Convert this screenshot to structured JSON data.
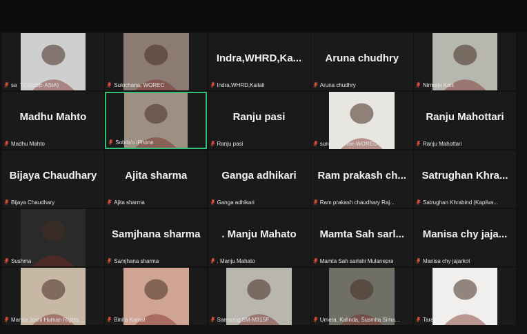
{
  "tiles": [
    {
      "name": "",
      "label": "sa  TOSUSE-ASIA)",
      "video": true,
      "bg": "#cfcfcf"
    },
    {
      "name": "",
      "label": "Sulochana, WOREC",
      "video": true,
      "bg": "#8c7b73"
    },
    {
      "name": "Indra,WHRD,Ka...",
      "label": "Indra,WHRD,Kailali",
      "video": false
    },
    {
      "name": "Aruna chudhry",
      "label": "Aruna chudhry",
      "video": false
    },
    {
      "name": "",
      "label": "Nirmala Kaili",
      "video": true,
      "bg": "#b7b7b0"
    },
    {
      "name": "Madhu Mahto",
      "label": "Madhu Mahto",
      "video": false
    },
    {
      "name": "",
      "label": "Sobita's iPhone",
      "video": true,
      "bg": "#9d8f82",
      "active": true
    },
    {
      "name": "Ranju pasi",
      "label": "Ranju pasi",
      "video": false
    },
    {
      "name": "",
      "label": "sunita, shelter-WOREC",
      "video": true,
      "bg": "#e8e6e1"
    },
    {
      "name": "Ranju Mahottari",
      "label": "Ranju Mahottari",
      "video": false
    },
    {
      "name": "Bijaya Chaudhary",
      "label": "Bijaya Chaudhary",
      "video": false
    },
    {
      "name": "Ajita sharma",
      "label": "Ajita sharma",
      "video": false
    },
    {
      "name": "Ganga adhikari",
      "label": "Ganga adhikari",
      "video": false
    },
    {
      "name": "Ram prakash ch...",
      "label": "Ram prakash chaudhary Raj...",
      "video": false
    },
    {
      "name": "Satrughan Khra...",
      "label": "Satrughan Khrabind (Kapilva...",
      "video": false
    },
    {
      "name": "",
      "label": "Sushma",
      "video": true,
      "bg": "#2a2a2a"
    },
    {
      "name": "Samjhana sharma",
      "label": "Samjhana sharma",
      "video": false
    },
    {
      "name": ". Manju Mahato",
      "label": ". Manju Mahato",
      "video": false
    },
    {
      "name": "Mamta Sah sarl...",
      "label": "Mamta Sah sarlahi Mulanepra",
      "video": false
    },
    {
      "name": "Manisa chy jaja...",
      "label": "Manisa chy jajarkot",
      "video": false
    },
    {
      "name": "",
      "label": "Mamta Joshi Human Rights ...",
      "video": true,
      "bg": "#c7b7a5"
    },
    {
      "name": "",
      "label": "Binita Kamat",
      "video": true,
      "bg": "#cfa493"
    },
    {
      "name": "",
      "label": "Samsung SM-M315F",
      "video": true,
      "bg": "#b8b6ae"
    },
    {
      "name": "",
      "label": "Umera, Kalinda, Susmita Sima...",
      "video": true,
      "bg": "#6f6f66"
    },
    {
      "name": "",
      "label": "Tara",
      "video": true,
      "bg": "#f0efed"
    }
  ],
  "colors": {
    "accent": "#35c07a",
    "tile_bg": "#1a1a1a",
    "mic_red": "#e0523a"
  },
  "icons": {
    "mic": "mic-muted-icon"
  }
}
